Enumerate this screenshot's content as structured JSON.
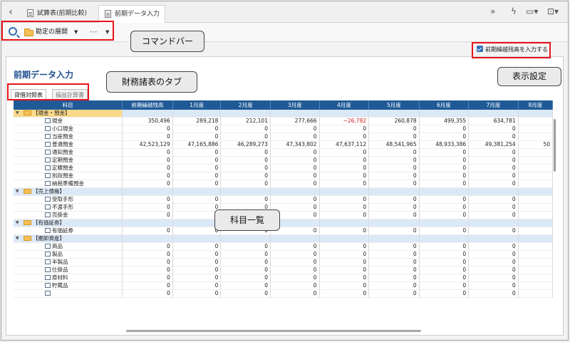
{
  "tabs": [
    {
      "label": "試算表(前期比較)",
      "active": false
    },
    {
      "label": "前期データ入力",
      "active": true
    }
  ],
  "top_icons": [
    "double-chevron-down-icon",
    "lightning-icon",
    "window-icon",
    "export-icon"
  ],
  "command_bar": {
    "expand_label": "勘定の展開",
    "more_label": "⋯"
  },
  "annotations": {
    "command_bar": "コマンドバー",
    "statement_tabs": "財務諸表のタブ",
    "display_settings": "表示設定",
    "account_list": "科目一覧"
  },
  "page": {
    "title": "前期データ入力",
    "checkbox_label": "前期繰越残高を入力する",
    "checkbox_checked": true
  },
  "statement_tabs": [
    {
      "label": "貸借対照表",
      "active": true
    },
    {
      "label": "損益計算書",
      "active": false
    }
  ],
  "table": {
    "headers": [
      "科目",
      "前期繰越残高",
      "1月度",
      "2月度",
      "3月度",
      "4月度",
      "5月度",
      "6月度",
      "7月度",
      "8月度"
    ],
    "rows": [
      {
        "type": "group",
        "selected": true,
        "name": "【現金・預金】",
        "values": [
          "",
          "",
          "",
          "",
          "",
          "",
          "",
          "",
          ""
        ]
      },
      {
        "type": "item",
        "name": "現金",
        "values": [
          "350,496",
          "289,218",
          "212,101",
          "277,666",
          "−26,782",
          "260,878",
          "499,355",
          "634,781",
          ""
        ]
      },
      {
        "type": "item",
        "name": "小口現金",
        "values": [
          "0",
          "0",
          "0",
          "0",
          "0",
          "0",
          "0",
          "0",
          ""
        ]
      },
      {
        "type": "item",
        "name": "当座預金",
        "values": [
          "0",
          "0",
          "0",
          "0",
          "0",
          "0",
          "0",
          "0",
          ""
        ]
      },
      {
        "type": "item",
        "name": "普通預金",
        "values": [
          "42,523,129",
          "47,165,886",
          "46,289,273",
          "47,343,802",
          "47,637,112",
          "48,541,965",
          "48,933,386",
          "49,381,254",
          "50"
        ]
      },
      {
        "type": "item",
        "name": "通知預金",
        "values": [
          "0",
          "0",
          "0",
          "0",
          "0",
          "0",
          "0",
          "0",
          ""
        ]
      },
      {
        "type": "item",
        "name": "定期預金",
        "values": [
          "0",
          "0",
          "0",
          "0",
          "0",
          "0",
          "0",
          "0",
          ""
        ]
      },
      {
        "type": "item",
        "name": "定積預金",
        "values": [
          "0",
          "0",
          "0",
          "0",
          "0",
          "0",
          "0",
          "0",
          ""
        ]
      },
      {
        "type": "item",
        "name": "別段預金",
        "values": [
          "0",
          "0",
          "0",
          "0",
          "0",
          "0",
          "0",
          "0",
          ""
        ]
      },
      {
        "type": "item",
        "name": "納税準備預金",
        "values": [
          "0",
          "0",
          "0",
          "0",
          "0",
          "0",
          "0",
          "0",
          ""
        ]
      },
      {
        "type": "group",
        "selected": false,
        "name": "【売上債権】",
        "values": [
          "",
          "",
          "",
          "",
          "",
          "",
          "",
          "",
          ""
        ]
      },
      {
        "type": "item",
        "name": "受取手形",
        "values": [
          "0",
          "0",
          "0",
          "0",
          "0",
          "0",
          "0",
          "0",
          ""
        ]
      },
      {
        "type": "item",
        "name": "不渡手形",
        "values": [
          "0",
          "0",
          "0",
          "0",
          "0",
          "0",
          "0",
          "0",
          ""
        ]
      },
      {
        "type": "item",
        "name": "売掛金",
        "values": [
          "0",
          "0",
          "0",
          "0",
          "0",
          "0",
          "0",
          "0",
          ""
        ]
      },
      {
        "type": "group",
        "selected": false,
        "name": "【有価証券】",
        "values": [
          "",
          "",
          "",
          "",
          "",
          "",
          "",
          "",
          ""
        ]
      },
      {
        "type": "item",
        "name": "有価証券",
        "values": [
          "0",
          "0",
          "0",
          "0",
          "0",
          "0",
          "0",
          "0",
          ""
        ]
      },
      {
        "type": "group",
        "selected": false,
        "name": "【棚卸資産】",
        "values": [
          "",
          "",
          "",
          "",
          "",
          "",
          "",
          "",
          ""
        ]
      },
      {
        "type": "item",
        "name": "商品",
        "values": [
          "0",
          "0",
          "0",
          "0",
          "0",
          "0",
          "0",
          "0",
          ""
        ]
      },
      {
        "type": "item",
        "name": "製品",
        "values": [
          "0",
          "0",
          "0",
          "0",
          "0",
          "0",
          "0",
          "0",
          ""
        ]
      },
      {
        "type": "item",
        "name": "半製品",
        "values": [
          "0",
          "0",
          "0",
          "0",
          "0",
          "0",
          "0",
          "0",
          ""
        ]
      },
      {
        "type": "item",
        "name": "仕掛品",
        "values": [
          "0",
          "0",
          "0",
          "0",
          "0",
          "0",
          "0",
          "0",
          ""
        ]
      },
      {
        "type": "item",
        "name": "原材料",
        "values": [
          "0",
          "0",
          "0",
          "0",
          "0",
          "0",
          "0",
          "0",
          ""
        ]
      },
      {
        "type": "item",
        "name": "貯蔵品",
        "values": [
          "0",
          "0",
          "0",
          "0",
          "0",
          "0",
          "0",
          "0",
          ""
        ]
      },
      {
        "type": "item",
        "name": "",
        "values": [
          "0",
          "0",
          "0",
          "0",
          "0",
          "0",
          "0",
          "0",
          ""
        ]
      }
    ]
  },
  "colors": {
    "header_bg": "#1f5a97",
    "group_row_bg": "#dbe8f7",
    "selected_group_bg": "#f9d98a",
    "annotation_red": "#e8141b",
    "negative_value": "#d42020",
    "title_blue": "#1e4f8c"
  }
}
